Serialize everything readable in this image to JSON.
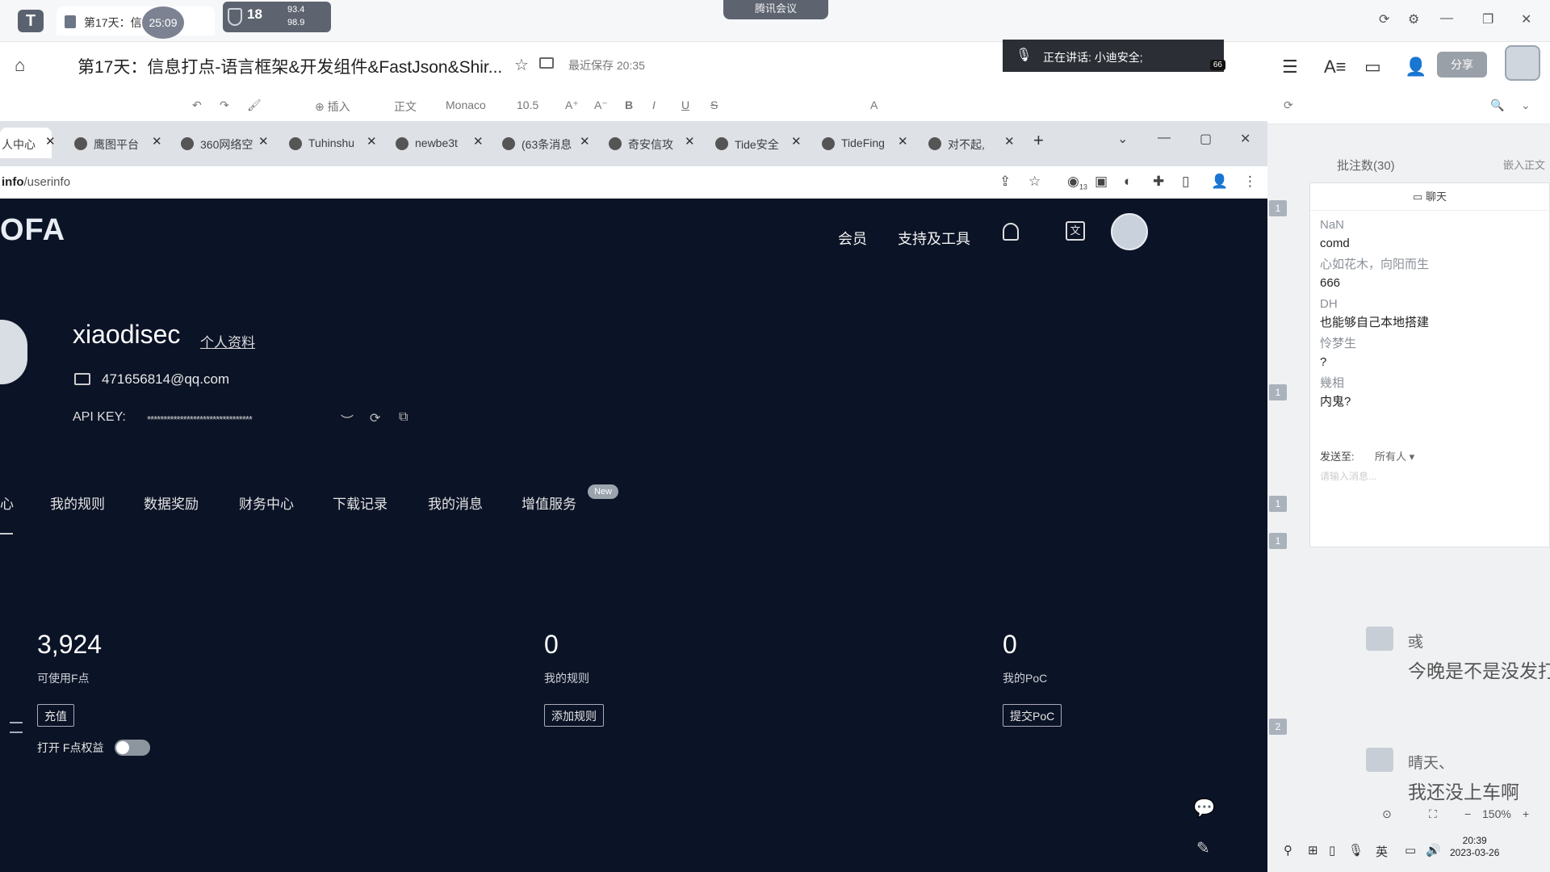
{
  "outer": {
    "doc_tab_title": "第17天：信...语言...",
    "timer": "25:09",
    "perf": {
      "cpu": "18",
      "net_up": "93.4",
      "net_down": "98.9"
    },
    "meeting_label": "腾讯会议",
    "doc_title": "第17天：信息打点-语言框架&开发组件&FastJson&Shir...",
    "save_status": "最近保存 20:35",
    "speaking": "正在讲话: 小迪安全;",
    "speaking_count": "66",
    "share_label": "分享",
    "format": {
      "insert": "插入",
      "style": "正文",
      "font": "Monaco",
      "size": "10.5"
    }
  },
  "browser": {
    "tabs": [
      {
        "label": "人中心",
        "active": true
      },
      {
        "label": "鹰图平台"
      },
      {
        "label": "360网络空"
      },
      {
        "label": "Tuhinshu"
      },
      {
        "label": "newbe3t"
      },
      {
        "label": "(63条消息"
      },
      {
        "label": "奇安信攻"
      },
      {
        "label": "Tide安全"
      },
      {
        "label": "TideFing"
      },
      {
        "label": "对不起,"
      }
    ],
    "url_host": "info",
    "url_path": "/userinfo",
    "ext_badge": "13"
  },
  "fofa": {
    "logo": "OFA",
    "nav": {
      "member": "会员",
      "tools": "支持及工具"
    },
    "username": "xiaodisec",
    "profile_link": "个人资料",
    "email": "471656814@qq.com",
    "api_label": "API KEY:",
    "api_key": "********************************",
    "menu": [
      "心",
      "我的规则",
      "数据奖励",
      "财务中心",
      "下载记录",
      "我的消息",
      "增值服务"
    ],
    "new_badge": "New",
    "stats": [
      {
        "value": "3,924",
        "label": "可使用F点",
        "button": "充值"
      },
      {
        "value": "0",
        "label": "我的规则",
        "button": "添加规则"
      },
      {
        "value": "0",
        "label": "我的PoC",
        "button": "提交PoC"
      }
    ],
    "fpoint_toggle_label": "打开 F点权益",
    "fpoint_toggle_on": false
  },
  "right_panel": {
    "comments_title": "批注数(30)",
    "insert_text": "嵌入正文",
    "markers": [
      "1",
      "1",
      "1",
      "1",
      "2"
    ],
    "chat": {
      "header": "聊天",
      "messages": [
        {
          "name": "NaN",
          "text": "comd"
        },
        {
          "name": "心如花木，向阳而生",
          "text": "666"
        },
        {
          "name": "DH",
          "text": "也能够自己本地搭建"
        },
        {
          "name": "怜梦生",
          "text": "?"
        },
        {
          "name": "幾相",
          "text": "内鬼?"
        }
      ],
      "send_to_label": "发送至:",
      "send_to_target": "所有人",
      "input_placeholder": "请输入消息..."
    },
    "bubbles": [
      {
        "name": "彧",
        "text": "今晚是不是没发打"
      },
      {
        "name": "晴天、",
        "text": "我还没上车啊"
      }
    ],
    "zoom": "150%",
    "clock_time": "20:39",
    "clock_date": "2023-03-26",
    "ime": "英"
  }
}
